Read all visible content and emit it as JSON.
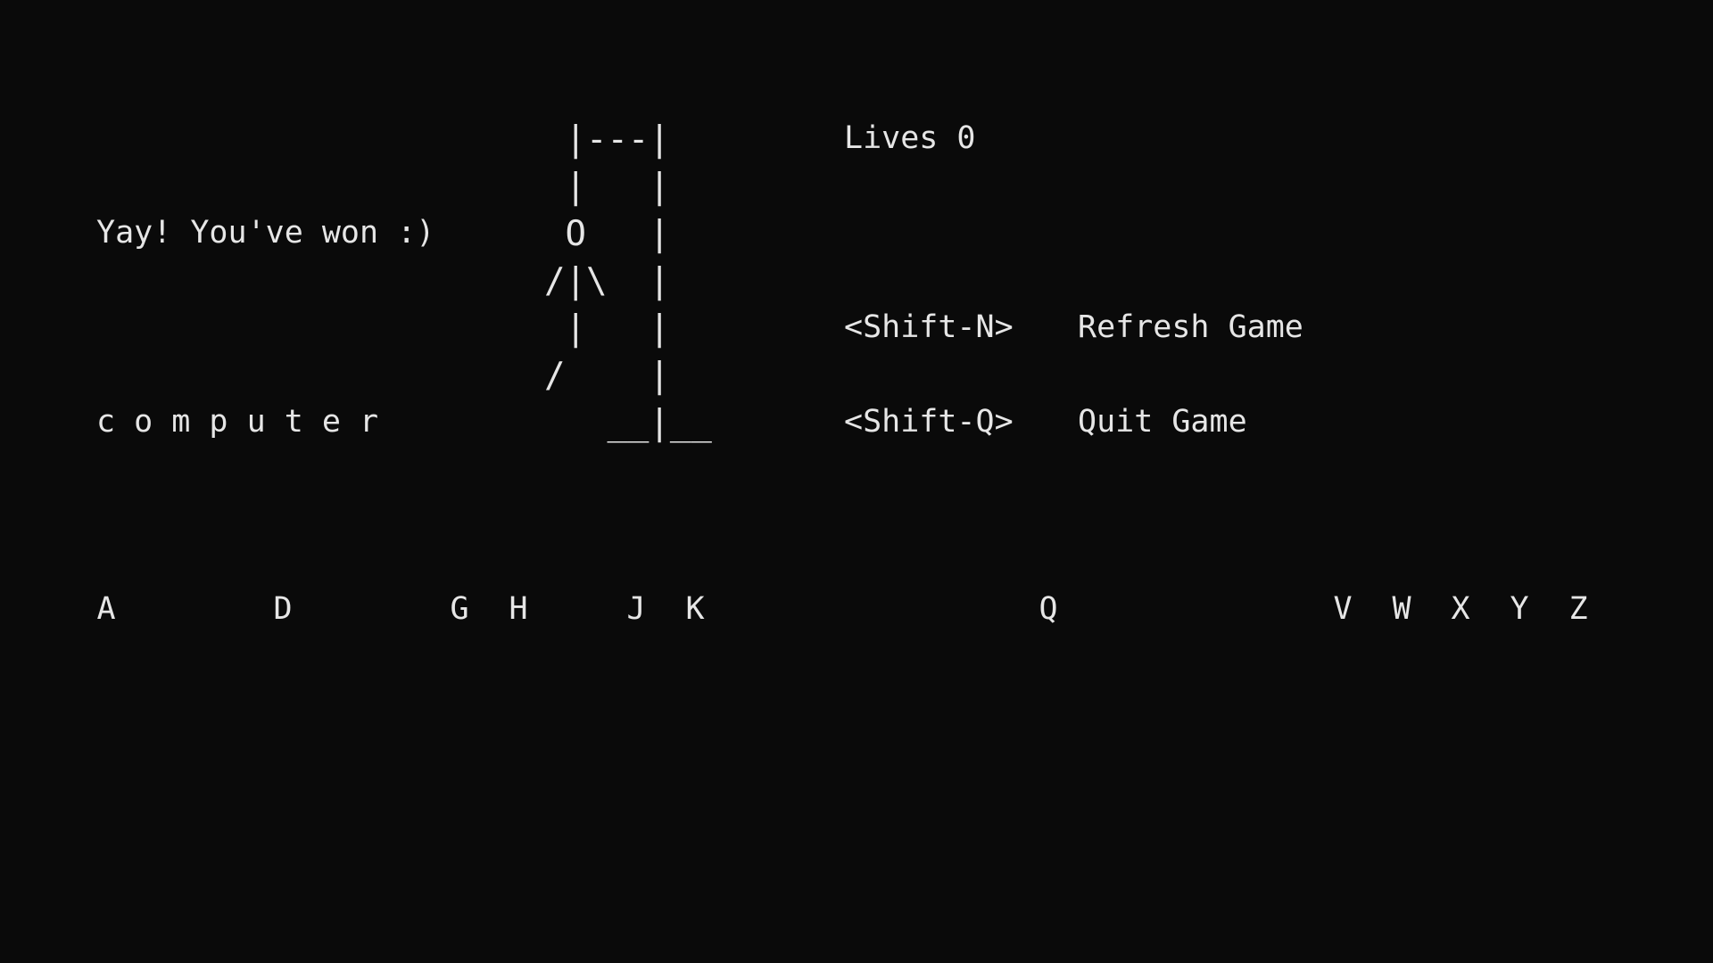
{
  "status": {
    "message": "Yay! You've won :)",
    "word": "c o m p u t e r",
    "lives_label": "Lives 0"
  },
  "gallows": {
    "art": " |---|\n |   |\n O   |\n/|\\  |\n |   |\n/    |\n   __|__"
  },
  "controls": [
    {
      "key": "<Shift-N>",
      "action": "Refresh Game"
    },
    {
      "key": "<Shift-Q>",
      "action": "Quit Game"
    }
  ],
  "remaining_letters": [
    "A",
    "D",
    "G",
    "H",
    "J",
    "K",
    "Q",
    "V",
    "W",
    "X",
    "Y",
    "Z"
  ],
  "colors": {
    "background": "#0a0a0a",
    "text": "#e6e6e6"
  }
}
